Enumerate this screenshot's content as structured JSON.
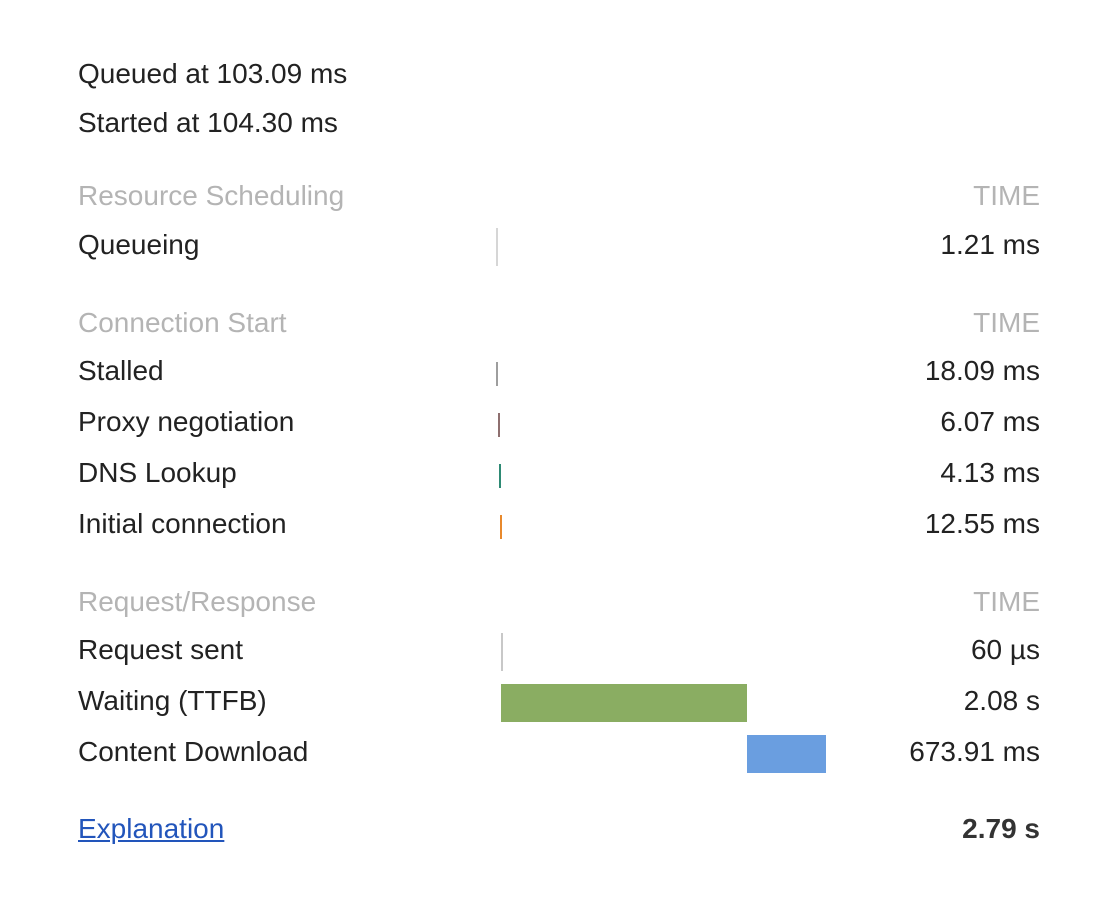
{
  "header": {
    "queued": "Queued at 103.09 ms",
    "started": "Started at 104.30 ms"
  },
  "sections": [
    {
      "title": "Resource Scheduling",
      "time_header": "TIME",
      "rows": [
        {
          "label": "Queueing",
          "value": "1.21 ms",
          "color": "#d6d6d6",
          "kind": "tick",
          "start_ms": 0,
          "duration_ms": 1.21
        }
      ]
    },
    {
      "title": "Connection Start",
      "time_header": "TIME",
      "rows": [
        {
          "label": "Stalled",
          "value": "18.09 ms",
          "color": "#9e9e9e",
          "kind": "tick",
          "start_ms": 1.21,
          "duration_ms": 18.09
        },
        {
          "label": "Proxy negotiation",
          "value": "6.07 ms",
          "color": "#8e6f6f",
          "kind": "tick",
          "start_ms": 19.3,
          "duration_ms": 6.07
        },
        {
          "label": "DNS Lookup",
          "value": "4.13 ms",
          "color": "#2e8a74",
          "kind": "tick",
          "start_ms": 25.37,
          "duration_ms": 4.13
        },
        {
          "label": "Initial connection",
          "value": "12.55 ms",
          "color": "#e8892c",
          "kind": "tick",
          "start_ms": 29.5,
          "duration_ms": 12.55
        }
      ]
    },
    {
      "title": "Request/Response",
      "time_header": "TIME",
      "rows": [
        {
          "label": "Request sent",
          "value": "60 µs",
          "color": "#c8c8c8",
          "kind": "tick",
          "start_ms": 42.05,
          "duration_ms": 0.06
        },
        {
          "label": "Waiting (TTFB)",
          "value": "2.08 s",
          "color": "#8aad62",
          "kind": "bar",
          "start_ms": 42.11,
          "duration_ms": 2080
        },
        {
          "label": "Content Download",
          "value": "673.91 ms",
          "color": "#6a9ee0",
          "kind": "bar",
          "start_ms": 2122.11,
          "duration_ms": 673.91
        }
      ]
    }
  ],
  "footer": {
    "link_label": "Explanation",
    "total": "2.79 s"
  },
  "timeline_total_ms": 2796
}
